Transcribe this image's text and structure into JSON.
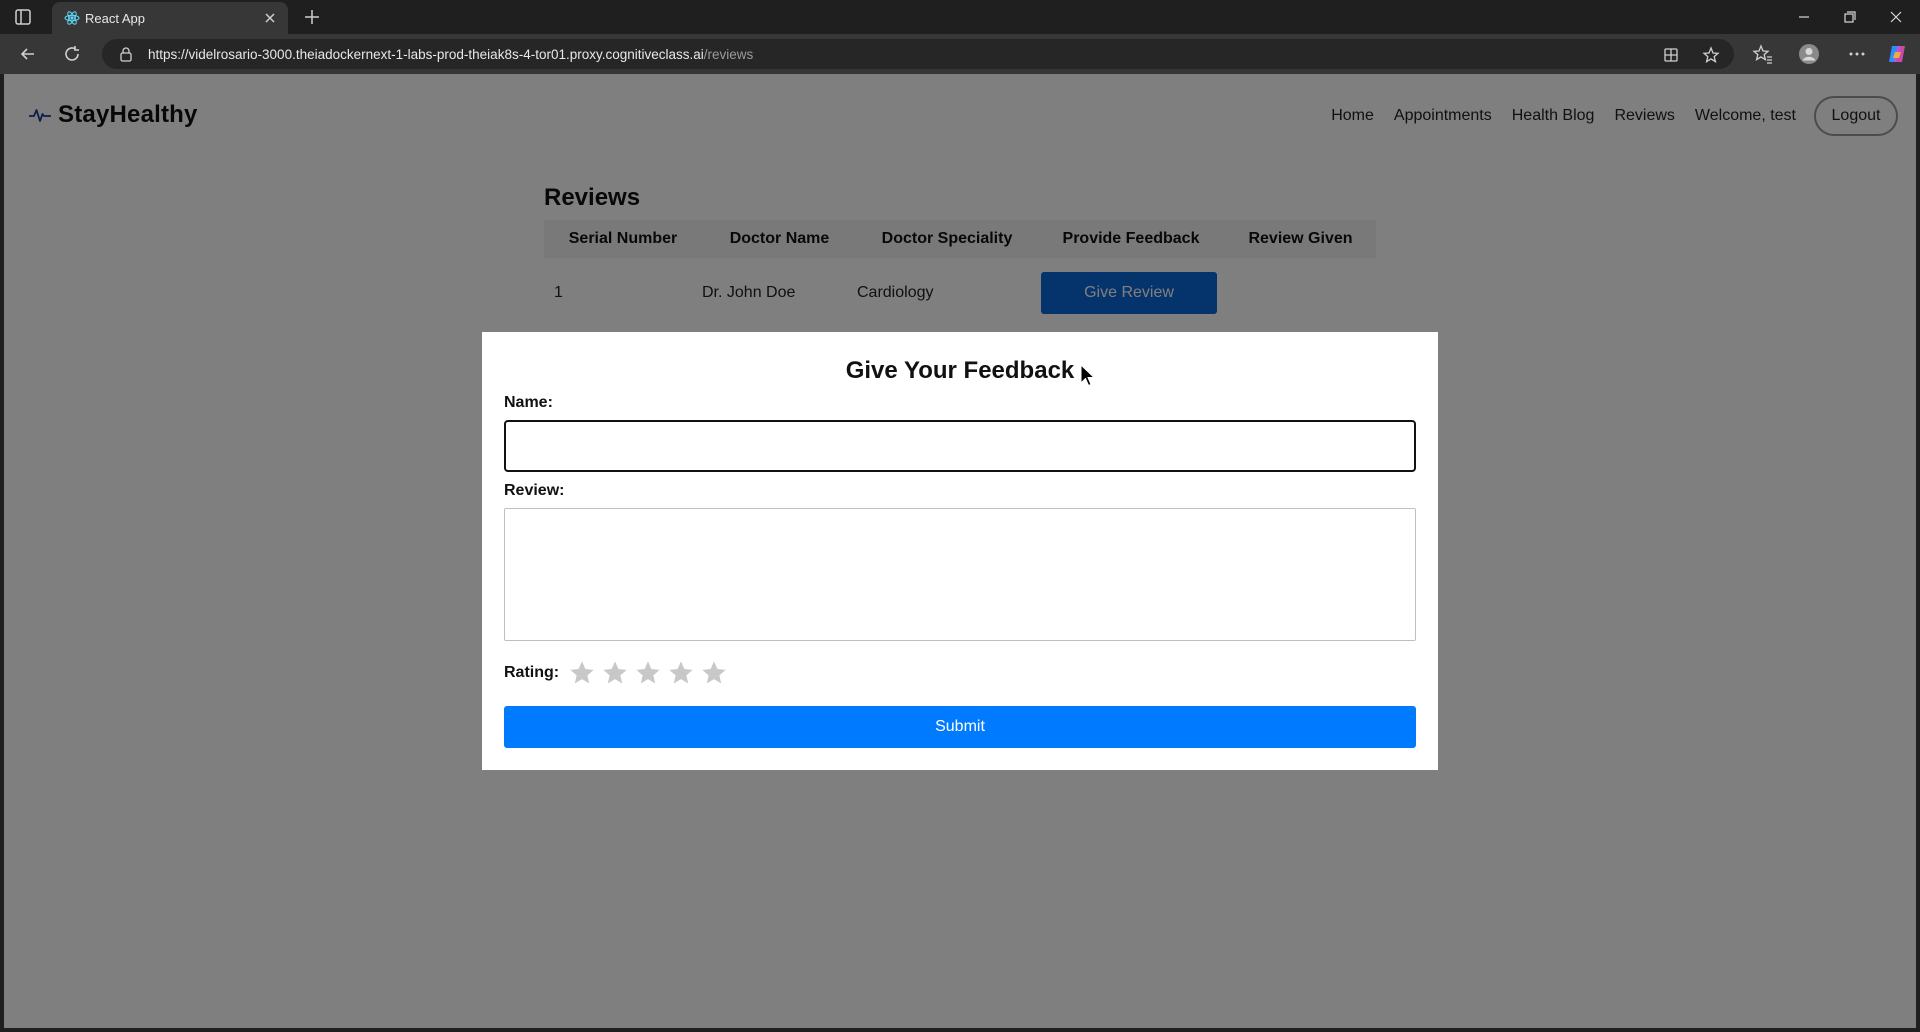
{
  "browser": {
    "tab_title": "React App",
    "url_host": "https://videlrosario-3000.theiadockernext-1-labs-prod-theiak8s-4-tor01.proxy.cognitiveclass.ai",
    "url_path": "/reviews"
  },
  "navbar": {
    "brand": "StayHealthy",
    "links": [
      "Home",
      "Appointments",
      "Health Blog",
      "Reviews"
    ],
    "welcome": "Welcome, test",
    "logout_label": "Logout"
  },
  "reviews": {
    "title": "Reviews",
    "columns": [
      "Serial Number",
      "Doctor Name",
      "Doctor Speciality",
      "Provide Feedback",
      "Review Given"
    ],
    "rows": [
      {
        "serial": "1",
        "doctor": "Dr. John Doe",
        "speciality": "Cardiology",
        "action_label": "Give Review",
        "review_given": ""
      }
    ]
  },
  "modal": {
    "title": "Give Your Feedback",
    "name_label": "Name:",
    "name_value": "",
    "review_label": "Review:",
    "review_value": "",
    "rating_label": "Rating:",
    "rating_value": 0,
    "rating_max": 5,
    "submit_label": "Submit"
  },
  "colors": {
    "primary": "#007bff",
    "brand_icon": "#1a3d8f",
    "overlay": "rgba(0,0,0,0.5)"
  },
  "icons": [
    "tab-actions-icon",
    "react-favicon-icon",
    "close-icon",
    "plus-icon",
    "minimize-icon",
    "restore-icon",
    "back-icon",
    "refresh-icon",
    "lock-icon",
    "apps-icon",
    "star-outline-icon",
    "favorites-icon",
    "profile-icon",
    "more-icon",
    "copilot-icon",
    "heartbeat-icon",
    "star-icon"
  ]
}
